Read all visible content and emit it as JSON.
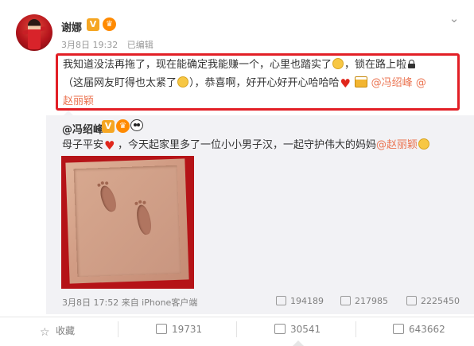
{
  "post": {
    "username": "谢娜",
    "meta": {
      "date": "3月8日 19:32",
      "edited": "已编辑"
    },
    "text": {
      "line1_a": "我知道没法再拖了，现在能确定我能赚一个，心里也踏实了",
      "line1_b": "，锁在路上啦",
      "line2_a": "（这届网友盯得也太紧了",
      "line2_b": "），恭喜啊，好开心好开心哈哈哈",
      "mention1": "@冯绍峰",
      "mention2": "@",
      "line3_mention": "赵丽颖"
    }
  },
  "repost": {
    "username": "@冯绍峰",
    "text_a": "母子平安",
    "text_b": "，今天起家里多了一位小小男子汉，一起守护伟大的妈妈",
    "mention": "@赵丽颖",
    "footer": {
      "date": "3月8日 17:52 来自 iPhone客户端",
      "reposts": "194189",
      "comments": "217985",
      "likes": "2225450"
    }
  },
  "actions": {
    "favorite": "收藏",
    "repost": "19731",
    "comment": "30541",
    "like": "643662"
  },
  "colors": {
    "accent": "#eb7350",
    "highlight_box": "#e21f26",
    "badge": "#f5a623"
  },
  "icons": [
    "chevron-down-icon",
    "verified-v-icon",
    "crown-icon",
    "panda-icon",
    "lock-icon",
    "heart-emoji",
    "smile-emoji",
    "beer-emoji",
    "tongue-emoji",
    "repost-icon",
    "comment-icon",
    "like-icon",
    "star-icon"
  ]
}
